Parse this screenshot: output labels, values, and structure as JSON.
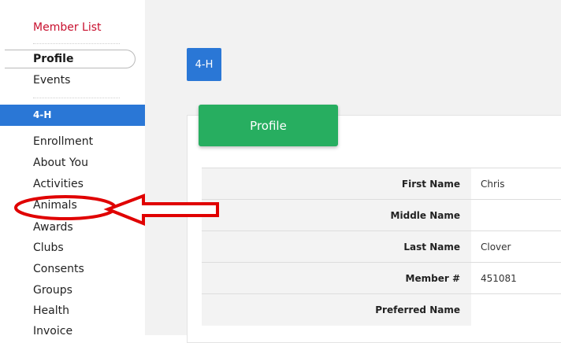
{
  "sidebar": {
    "member_list": "Member List",
    "profile": "Profile",
    "events": "Events",
    "section": "4-H",
    "items": [
      "Enrollment",
      "About You",
      "Activities",
      "Animals",
      "Awards",
      "Clubs",
      "Consents",
      "Groups",
      "Health",
      "Invoice"
    ]
  },
  "main": {
    "badge": "4-H",
    "tab": "Profile",
    "fields": [
      {
        "label": "First Name",
        "value": "Chris"
      },
      {
        "label": "Middle Name",
        "value": ""
      },
      {
        "label": "Last Name",
        "value": "Clover"
      },
      {
        "label": "Member #",
        "value": "451081"
      },
      {
        "label": "Preferred Name",
        "value": ""
      }
    ]
  },
  "colors": {
    "accent_blue": "#2a77d6",
    "tab_green": "#27ae60",
    "link_red": "#c8102e",
    "annotation_red": "#e00000"
  }
}
